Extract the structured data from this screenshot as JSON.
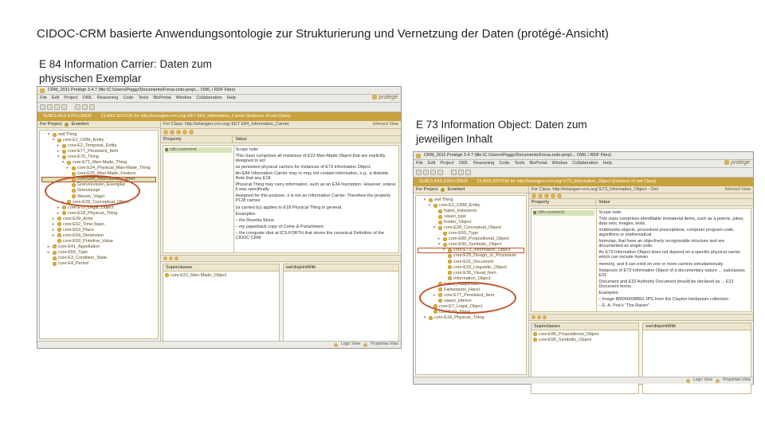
{
  "slide": {
    "title": "CIDOC-CRM basierte Anwendungsontologie zur Strukturierung und Vernetzung der Daten (protégé-Ansicht)",
    "caption_left_1": "E 84 Information Carrier: Daten zum",
    "caption_left_2": "physischen Exemplar",
    "caption_right_1": "E 73 Information Object: Daten zum",
    "caption_right_2": "jeweiligen Inhalt"
  },
  "common": {
    "logo": "protégé",
    "menu": [
      "File",
      "Edit",
      "Project",
      "OWL",
      "Reasoning",
      "Code",
      "Tools",
      "BioPortal",
      "Window",
      "Collaboration",
      "Help"
    ],
    "menu2": [
      "File",
      "Edit",
      "Project",
      "OWL",
      "Reasoning",
      "Code",
      "Tools",
      "BioPortal",
      "Window",
      "Collaboration",
      "Help"
    ],
    "status_logic": "Logic View",
    "status_props": "Properties View"
  },
  "left_app": {
    "title": "CRM_2011 Protégé 3.4.7  (file:\\C:\\Users\\Peggy\\Documents\\Forsa-onto-prep\\...  OWL / RDF Files)",
    "classbar_left": "SUBCLASS EXPLORER",
    "classbar_right": "CLASS EDITOR for http://erlangen-crm.org/ EET  E84_Information_Carrier   (instance of owl:Class)",
    "for_project": "For Project:",
    "project": "Erweitert",
    "for_class": "For Class:",
    "class_uri": "http://erlangen-crm.org/ EET  E84_Information_Carrier",
    "inferred": "Inferred View",
    "prop_h1": "Property",
    "prop_h2": "Value",
    "tree": [
      {
        "ind": 1,
        "tw": "▾",
        "lbl": "owl:Thing"
      },
      {
        "ind": 2,
        "tw": "▾",
        "lbl": "core:E1_CRM_Entity"
      },
      {
        "ind": 3,
        "tw": "▸",
        "lbl": "core:E2_Temporal_Entity"
      },
      {
        "ind": 3,
        "tw": "▸",
        "lbl": "core:E77_Persistent_Item"
      },
      {
        "ind": 3,
        "tw": "▾",
        "lbl": "core:E70_Thing"
      },
      {
        "ind": 4,
        "tw": "▾",
        "lbl": "core:E71_Man-Made_Thing"
      },
      {
        "ind": 5,
        "tw": "▸",
        "lbl": "core:E24_Physical_Man-Made_Thing"
      },
      {
        "ind": 5,
        "tw": "",
        "lbl": "core:E25_Man-Made_Feature"
      },
      {
        "ind": 5,
        "tw": "",
        "lbl": "core:E84_Information_Carrier",
        "sel": true,
        "hl": true
      },
      {
        "ind": 5,
        "tw": "",
        "lbl": "Grenzrevision_Exemplar"
      },
      {
        "ind": 5,
        "tw": "",
        "lbl": "Grenzrezge"
      },
      {
        "ind": 5,
        "tw": "",
        "lbl": "Wesen_Vogel"
      },
      {
        "ind": 4,
        "tw": "▸",
        "lbl": "core:E28_Conceptual_Object"
      },
      {
        "ind": 3,
        "tw": "▸",
        "lbl": "core:E72_Legal_Object"
      },
      {
        "ind": 3,
        "tw": "▸",
        "lbl": "core:E18_Physical_Thing"
      },
      {
        "ind": 2,
        "tw": "▸",
        "lbl": "core:E39_Actor"
      },
      {
        "ind": 2,
        "tw": "▸",
        "lbl": "core:E52_Time-Span"
      },
      {
        "ind": 2,
        "tw": "▸",
        "lbl": "core:E53_Place"
      },
      {
        "ind": 2,
        "tw": "▸",
        "lbl": "core:E54_Dimension"
      },
      {
        "ind": 2,
        "tw": "",
        "lbl": "core:E59_Primitive_Value"
      },
      {
        "ind": 1,
        "tw": "▸",
        "lbl": "core:E41_Appellation"
      },
      {
        "ind": 1,
        "tw": "▸",
        "lbl": "core:E55_Type"
      },
      {
        "ind": 1,
        "tw": "",
        "lbl": "core:E3_Condition_State"
      },
      {
        "ind": 1,
        "tw": "",
        "lbl": "core:E4_Period"
      }
    ],
    "props": [
      {
        "lbl": "rdfs:comment",
        "sel": true
      }
    ],
    "comment_lines": [
      "Scope note:",
      "This class comprises all instances of E22 Man-Made Object that are explicitly designed to act",
      "as persistent physical carriers for instances of E73 Information Object.",
      "An E84 Information Carrier may or may not contain information, e.g., a diskette. Note that any E18",
      "Physical Thing may carry information, such as an E34 Inscription. However, unless it was specifically",
      "designed for this purpose, it is not an Information Carrier. Therefore the property P128 carries",
      "(is carried by) applies to E18 Physical Thing in general.",
      "",
      "Examples:",
      "– the Rosetta Stone",
      "– my paperback copy of Crime & Punishment",
      "– the computer disk at ICS-FORTH that stores the canonical Definition of the CIDOC CRM"
    ],
    "lower_left_title": "Superclasses",
    "lower_left_items": [
      "core:E22_Man-Made_Object"
    ],
    "lower_right_title": "owl:disjointWith"
  },
  "right_app": {
    "title": "CRM_2011 Protégé 3.4.7  (file:\\C:\\Users\\Peggy\\Documents\\Forsa-onto-prep\\... OWL / RDF Files)",
    "classbar_left": "SUBCLASS EXPLORER",
    "classbar_right": "CLASS EDITOR for http://erlangen-crm.org/ E73_Information_Object   (instance of owl:Class)",
    "for_project": "For Project:",
    "project": "Erweitert",
    "for_class": "For Class:",
    "class_uri": "http://erlangen-crm.org/ E73_Information_Object - Owl",
    "inferred": "Inferred View",
    "prop_h1": "Property",
    "prop_h2": "Value",
    "tree": [
      {
        "ind": 1,
        "tw": "▾",
        "lbl": "owl:Thing"
      },
      {
        "ind": 2,
        "tw": "▾",
        "lbl": "core:E1_CRM_Entity"
      },
      {
        "ind": 3,
        "tw": "",
        "lbl": "habet_Indexterm"
      },
      {
        "ind": 3,
        "tw": "",
        "lbl": "vasari_type"
      },
      {
        "ind": 3,
        "tw": "",
        "lbl": "hristor_Object"
      },
      {
        "ind": 3,
        "tw": "▾",
        "lbl": "core:E28_Conceptual_Object"
      },
      {
        "ind": 4,
        "tw": "",
        "lbl": "core:E55_Type"
      },
      {
        "ind": 4,
        "tw": "▸",
        "lbl": "core:E89_Propositional_Object"
      },
      {
        "ind": 4,
        "tw": "▾",
        "lbl": "core:E90_Symbolic_Object"
      },
      {
        "ind": 5,
        "tw": "▾",
        "lbl": "core:E73_Information_Object",
        "hl": true
      },
      {
        "ind": 5,
        "tw": "",
        "lbl": "core:E29_Design_or_Procedure"
      },
      {
        "ind": 5,
        "tw": "",
        "lbl": "core:E31_Document"
      },
      {
        "ind": 5,
        "tw": "",
        "lbl": "core:E33_Linguistic_Object"
      },
      {
        "ind": 5,
        "tw": "",
        "lbl": "core:E36_Visual_Item"
      },
      {
        "ind": 5,
        "tw": "",
        "lbl": "Information_Object"
      },
      {
        "ind": 3,
        "tw": "",
        "lbl": "habet_Hauptcode"
      },
      {
        "ind": 3,
        "tw": "",
        "lbl": "Farbenpool_Hanzi"
      },
      {
        "ind": 3,
        "tw": "▸",
        "lbl": "core:E77_Persistent_Item"
      },
      {
        "ind": 3,
        "tw": "",
        "lbl": "vasari_inferno"
      },
      {
        "ind": 2,
        "tw": "▸",
        "lbl": "core:E7_Legal_Object"
      },
      {
        "ind": 2,
        "tw": "",
        "lbl": "core:E70_Thing"
      },
      {
        "ind": 1,
        "tw": "▾",
        "lbl": "core:E18_Physical_Thing"
      }
    ],
    "props": [
      {
        "lbl": "rdfs:comment",
        "sel": true
      }
    ],
    "comment_lines": [
      "Scope note:",
      "This class comprises identifiable immaterial items, such as a poems, jokes, data sets, images, texts,",
      "multimedia objects, procedural prescriptions, computer program code, algorithms or mathematical",
      "formulae, that have an objectively recognizable structure and are documented as single units.",
      "",
      "An E73 Information Object does not depend on a specific physical carrier, which can include human",
      "memory, and it can exist on one or more carriers simultaneously.",
      "Instances of E73 Information Object of a documentary nature ... subclasses E31",
      "Document and E32 Authority Document should be declared as ... E31 Document forms.",
      "",
      "Examples:",
      "– image BM000038850.JPG from the Clayton Herbarium collection",
      "– E. A. Poe's \"The Raven\""
    ],
    "lower_left_title": "Superclasses",
    "lower_left_items": [
      "core:E89_Propositional_Object",
      "core:E90_Symbolic_Object"
    ],
    "lower_right_title": "owl:disjointWith"
  }
}
